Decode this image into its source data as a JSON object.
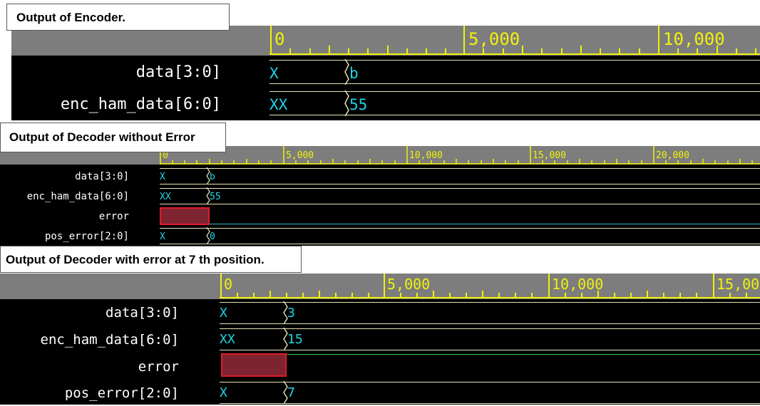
{
  "colors": {
    "background": "#000000",
    "ruler_bg": "#7d7d7d",
    "ruler": "#f1f10a",
    "signal_name": "#ffffff",
    "signal_value": "#1fd3e6",
    "bus_line": "#e7e3b8",
    "error_fill": "#7e2431",
    "error_border": "#e01a2a"
  },
  "sections": [
    {
      "caption": "Output of Encoder.",
      "ruler": {
        "labels": [
          "0",
          "5,000",
          "10,000"
        ]
      },
      "signals": [
        {
          "name": "data[3:0]",
          "initial": "X",
          "value": "b"
        },
        {
          "name": "enc_ham_data[6:0]",
          "initial": "XX",
          "value": "55"
        }
      ]
    },
    {
      "caption": "Output of Decoder without Error",
      "ruler": {
        "labels": [
          "0",
          "5,000",
          "10,000",
          "15,000",
          "20,000"
        ]
      },
      "signals": [
        {
          "name": "data[3:0]",
          "initial": "X",
          "value": "b"
        },
        {
          "name": "enc_ham_data[6:0]",
          "initial": "XX",
          "value": "55"
        },
        {
          "name": "error",
          "initial": "",
          "value": ""
        },
        {
          "name": "pos_error[2:0]",
          "initial": "X",
          "value": "0"
        }
      ]
    },
    {
      "caption": "Output of Decoder with error at 7 th position.",
      "ruler": {
        "labels": [
          "0",
          "5,000",
          "10,000",
          "15,00"
        ]
      },
      "signals": [
        {
          "name": "data[3:0]",
          "initial": "X",
          "value": "3"
        },
        {
          "name": "enc_ham_data[6:0]",
          "initial": "XX",
          "value": "15"
        },
        {
          "name": "error",
          "initial": "",
          "value": ""
        },
        {
          "name": "pos_error[2:0]",
          "initial": "X",
          "value": "7"
        }
      ]
    }
  ]
}
